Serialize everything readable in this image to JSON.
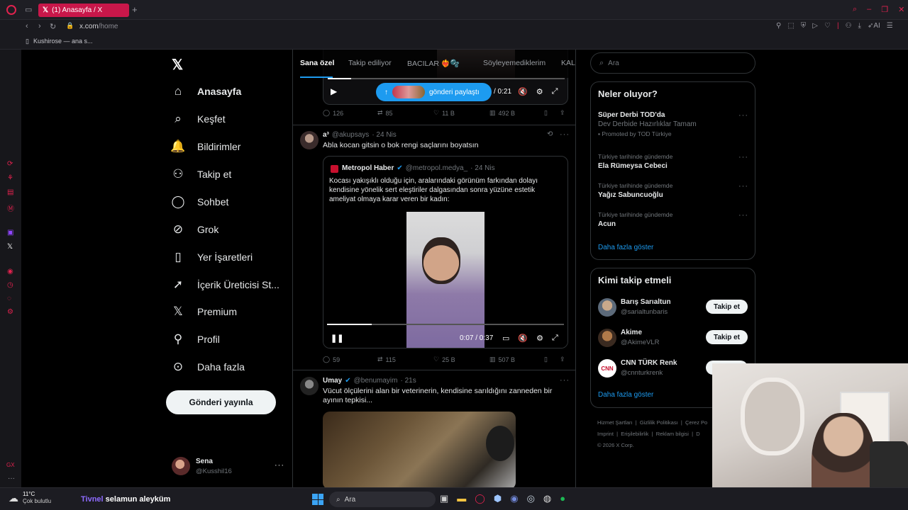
{
  "browser": {
    "tab_title": "(1) Anasayfa / X",
    "url_domain": "x.com",
    "url_path": "/home",
    "bookmark": "Kushirose — ana s...",
    "accent": "#c8174a"
  },
  "nav": {
    "items": [
      {
        "label": "Anasayfa",
        "icon": "home-icon"
      },
      {
        "label": "Keşfet",
        "icon": "search-icon"
      },
      {
        "label": "Bildirimler",
        "icon": "bell-icon"
      },
      {
        "label": "Takip et",
        "icon": "add-person-icon"
      },
      {
        "label": "Sohbet",
        "icon": "chat-icon"
      },
      {
        "label": "Grok",
        "icon": "grok-icon"
      },
      {
        "label": "Yer İşaretleri",
        "icon": "bookmark-icon"
      },
      {
        "label": "İçerik Üreticisi St...",
        "icon": "rocket-icon"
      },
      {
        "label": "Premium",
        "icon": "x-icon"
      },
      {
        "label": "Profil",
        "icon": "person-icon"
      },
      {
        "label": "Daha fazla",
        "icon": "more-circle-icon"
      }
    ],
    "post_button": "Gönderi yayınla",
    "user_name": "Sena",
    "user_handle": "@Kusshil16"
  },
  "feed": {
    "tabs": [
      "Sana özel",
      "Takip ediliyor",
      "BACILAR ❤️‍🔥🫧",
      "Söyleyemediklerim",
      "KAL"
    ],
    "top_video": {
      "share_label": "gönderi paylaştı",
      "time": "/ 0:21"
    },
    "top_stats": {
      "replies": "126",
      "reposts": "85",
      "likes": "11 B",
      "views": "492 B"
    },
    "tweet1": {
      "name": "a³",
      "handle": "@akupsays",
      "time": "· 24 Nis",
      "text": "Abla kocan gitsin o bok rengi saçlarını boyatsın",
      "quote_name": "Metropol Haber",
      "quote_handle": "@metropol.medya_",
      "quote_time": "· 24 Nis",
      "quote_text": "Kocası yakışıklı olduğu için, aralarındaki görünüm farkından dolayı kendisine yönelik sert eleştiriler dalgasından sonra yüzüne estetik ameliyat olmaya karar veren bir kadın:",
      "video_time": "0:07 / 0:37",
      "video_progress": 0.19,
      "stats": {
        "replies": "59",
        "reposts": "115",
        "likes": "25 B",
        "views": "507 B"
      }
    },
    "tweet2": {
      "name": "Umay",
      "handle": "@benumayim",
      "time": "· 21s",
      "text": "Vücut ölçülerini alan bir veterinerin, kendisine sarıldığını zanneden bir ayının tepkisi..."
    }
  },
  "right": {
    "search_placeholder": "Ara",
    "trends_title": "Neler oluyor?",
    "trends": [
      {
        "title": "Süper Derbi TOD'da",
        "sub": "Dev Derbide Hazırlıklar Tamam",
        "promo": "Promoted by TOD Türkiye"
      },
      {
        "context": "Türkiye tarihinde gündemde",
        "title": "Ela Rümeysa Cebeci"
      },
      {
        "context": "Türkiye tarihinde gündemde",
        "title": "Yağız Sabuncuoğlu"
      },
      {
        "context": "Türkiye tarihinde gündemde",
        "title": "Acun"
      }
    ],
    "show_more": "Daha fazla göster",
    "follow_title": "Kimi takip etmeli",
    "follow": [
      {
        "name": "Barış Sarıaltun",
        "handle": "@sarialtunbaris",
        "button": "Takip et"
      },
      {
        "name": "Akime",
        "handle": "@AkimeVLR",
        "button": "Takip et"
      },
      {
        "name": "CNN TÜRK Renk",
        "handle": "@cnnturkrenk",
        "button": "Takip et"
      }
    ],
    "follow_more": "Daha fazla göster",
    "footer": [
      "Hizmet Şartları",
      "Gizlilik Politikası",
      "Çerez Po",
      "Imprint",
      "Erişilebilirlik",
      "Reklam bilgisi",
      "D",
      "© 2026 X Corp."
    ]
  },
  "taskbar": {
    "temp": "11°C",
    "weather": "Çok bulutlu",
    "chat_user": "Tivnel",
    "chat_msg": "selamun aleyküm",
    "search": "Ara"
  }
}
